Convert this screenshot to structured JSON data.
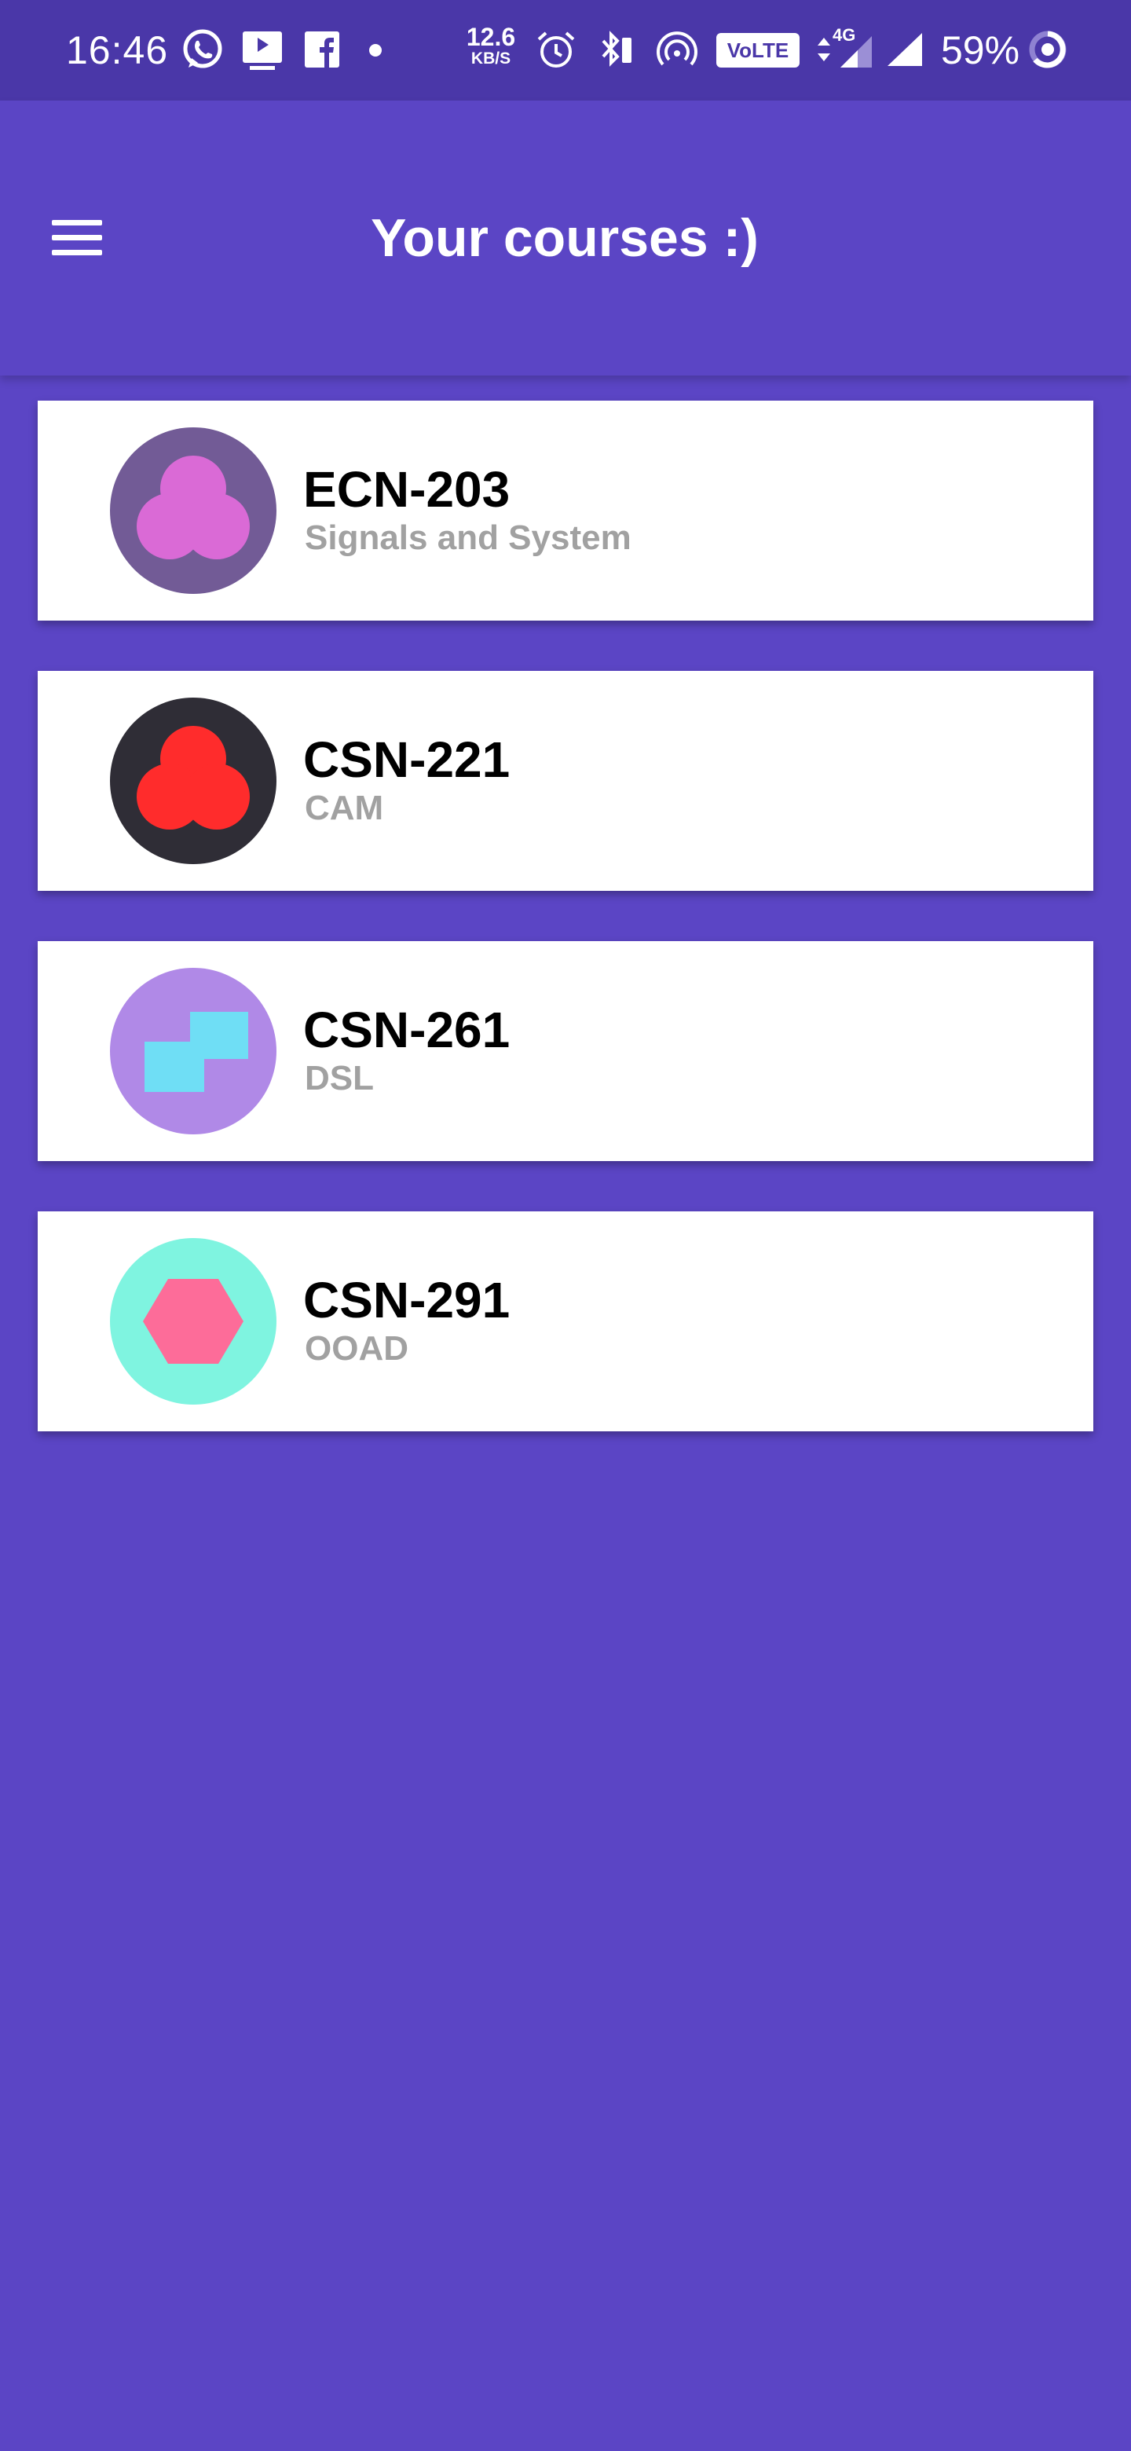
{
  "status_bar": {
    "time": "16:46",
    "notification_icons": [
      "whatsapp-icon",
      "youtube-icon",
      "facebook-icon"
    ],
    "net_speed_value": "12.6",
    "net_speed_unit": "KB/S",
    "volte_label": "VoLTE",
    "net_type": "4G",
    "battery_percent": "59%"
  },
  "app_bar": {
    "title": "Your courses :)",
    "menu_icon": "hamburger-menu-icon"
  },
  "courses": [
    {
      "code": "ECN-203",
      "name": "Signals and System",
      "avatar_icon": "trefoil-icon",
      "avatar_bg": "#725b96",
      "avatar_fg": "#da6ad6"
    },
    {
      "code": "CSN-221",
      "name": "CAM",
      "avatar_icon": "trefoil-icon",
      "avatar_bg": "#2f2d36",
      "avatar_fg": "#ff2c2c"
    },
    {
      "code": "CSN-261",
      "name": "DSL",
      "avatar_icon": "stepped-blocks-icon",
      "avatar_bg": "#b089e7",
      "avatar_fg": "#6fdef5"
    },
    {
      "code": "CSN-291",
      "name": "OOAD",
      "avatar_icon": "hexagon-icon",
      "avatar_bg": "#7ff4e0",
      "avatar_fg": "#fd6c99"
    }
  ],
  "colors": {
    "primary": "#5b45c5",
    "status_bar": "#4a37a8",
    "card": "#ffffff",
    "course_code_text": "#000000",
    "course_name_text": "#a1a1a1"
  }
}
